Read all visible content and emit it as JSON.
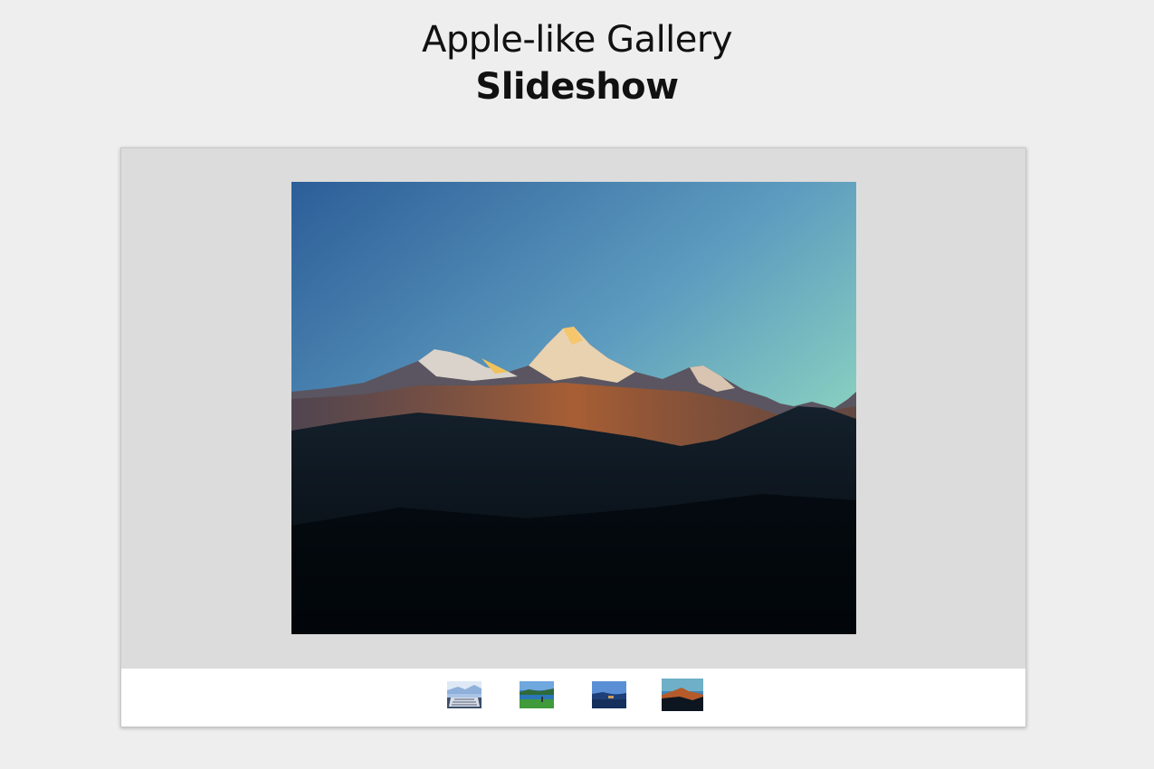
{
  "header": {
    "title_line1": "Apple-like Gallery",
    "title_line2": "Slideshow"
  },
  "gallery": {
    "active_index": 3,
    "main_image": "mountain-sunrise-photo",
    "thumbnails": [
      {
        "name": "thumbnail-1",
        "depicts": "pier-and-sky-photo"
      },
      {
        "name": "thumbnail-2",
        "depicts": "green-lake-landscape-photo"
      },
      {
        "name": "thumbnail-3",
        "depicts": "blue-coast-photo"
      },
      {
        "name": "thumbnail-4",
        "depicts": "mountain-sunrise-photo"
      }
    ]
  },
  "colors": {
    "page_background": "#eeeeee",
    "stage_background": "#dcdcdc",
    "thumb_bar_background": "#ffffff"
  }
}
